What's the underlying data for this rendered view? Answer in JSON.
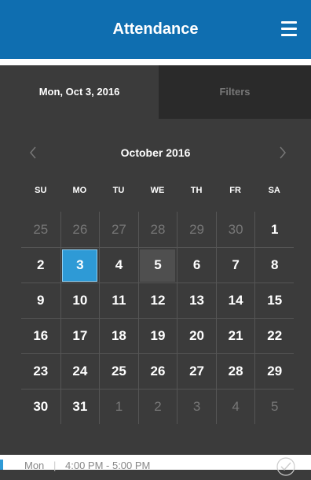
{
  "header": {
    "title": "Attendance",
    "menu_icon": "hamburger-menu-icon"
  },
  "colors": {
    "header_bg": "#0f6eb0",
    "selected": "#2e9ad6",
    "today": "#4f4f4f",
    "background": "#3b3b3b"
  },
  "tabs": [
    {
      "label": "Mon, Oct 3, 2016",
      "active": true
    },
    {
      "label": "Filters",
      "active": false
    }
  ],
  "calendar": {
    "month_label": "October 2016",
    "prev_icon": "chevron-left-icon",
    "next_icon": "chevron-right-icon",
    "weekdays": [
      "SU",
      "MO",
      "TU",
      "WE",
      "TH",
      "FR",
      "SA"
    ],
    "weeks": [
      [
        "25",
        "26",
        "27",
        "28",
        "29",
        "30",
        "1"
      ],
      [
        "2",
        "3",
        "4",
        "5",
        "6",
        "7",
        "8"
      ],
      [
        "9",
        "10",
        "11",
        "12",
        "13",
        "14",
        "15"
      ],
      [
        "16",
        "17",
        "18",
        "19",
        "20",
        "21",
        "22"
      ],
      [
        "23",
        "24",
        "25",
        "26",
        "27",
        "28",
        "29"
      ],
      [
        "30",
        "31",
        "1",
        "2",
        "3",
        "4",
        "5"
      ]
    ],
    "selected_day": "3",
    "today_day": "5"
  },
  "entry": {
    "day": "Mon",
    "separator": "|",
    "time": "4:00 PM - 5:00 PM",
    "status_icon": "check-circle-icon"
  }
}
